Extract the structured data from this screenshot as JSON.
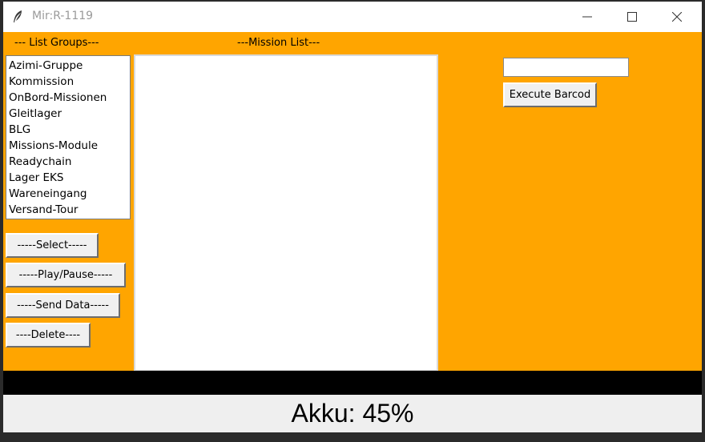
{
  "window": {
    "title": "Mir:R-1119",
    "controls": {
      "minimize_icon": "minimize-icon",
      "maximize_icon": "maximize-icon",
      "close_icon": "close-icon"
    }
  },
  "colors": {
    "background": "#ffa500",
    "status_bar": "#efefef",
    "band": "#000000"
  },
  "labels": {
    "list_groups": "--- List Groups---",
    "mission_list": "---Mission List---"
  },
  "groups": [
    {
      "label": "Azimi-Gruppe"
    },
    {
      "label": "Kommission"
    },
    {
      "label": "OnBord-Missionen"
    },
    {
      "label": "Gleitlager"
    },
    {
      "label": "BLG"
    },
    {
      "label": "Missions-Module"
    },
    {
      "label": "Readychain"
    },
    {
      "label": "Lager EKS"
    },
    {
      "label": "Wareneingang"
    },
    {
      "label": "Versand-Tour"
    }
  ],
  "buttons": {
    "select": "-----Select-----",
    "play_pause": "-----Play/Pause-----",
    "send_data": "-----Send Data-----",
    "delete": "----Delete----",
    "execute_barcode": "Execute Barcod"
  },
  "barcode": {
    "value": ""
  },
  "status": {
    "battery_text": "Akku: 45%"
  }
}
